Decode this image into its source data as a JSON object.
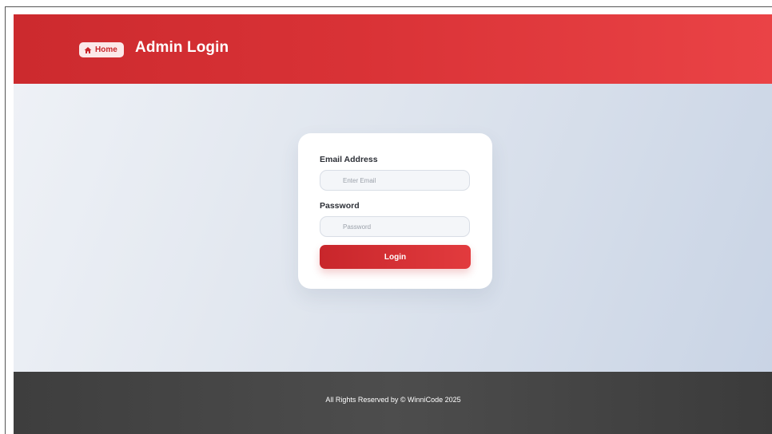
{
  "header": {
    "home_label": "Home",
    "title": "Admin Login"
  },
  "login_form": {
    "email_label": "Email Address",
    "email_placeholder": "Enter Email",
    "email_value": "",
    "password_label": "Password",
    "password_placeholder": "Password",
    "password_value": "",
    "submit_label": "Login"
  },
  "footer": {
    "copyright": "All Rights Reserved by © WinniCode 2025"
  },
  "colors": {
    "brand_red": "#d93236",
    "footer_gray": "#444444"
  },
  "icons": {
    "home": "home-icon"
  }
}
